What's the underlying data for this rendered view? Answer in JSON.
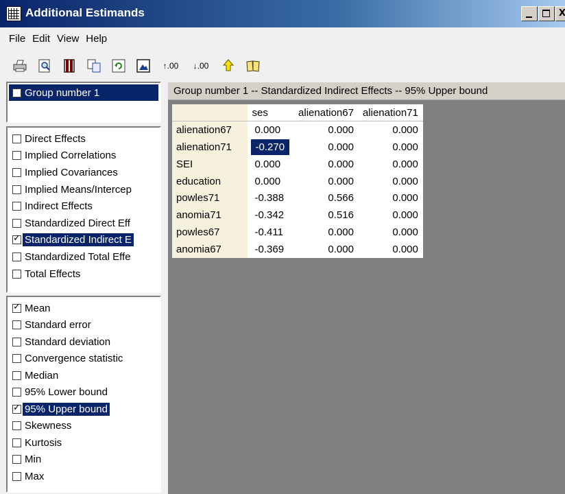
{
  "window": {
    "title": "Additional Estimands",
    "controls": {
      "minimize": "_",
      "maximize": "□",
      "close": "X"
    }
  },
  "menu": {
    "items": [
      {
        "label": "File"
      },
      {
        "label": "Edit"
      },
      {
        "label": "View"
      },
      {
        "label": "Help"
      }
    ]
  },
  "toolbar": {
    "icons": [
      "print-icon",
      "print-preview-icon",
      "columns-icon",
      "copy-icon",
      "refresh-icon",
      "image-icon",
      "increase-decimals-icon",
      "decrease-decimals-icon",
      "up-arrow-icon",
      "help-book-icon"
    ],
    "increase_decimals_text": ".00",
    "decrease_decimals_text": ".00"
  },
  "groups": {
    "items": [
      {
        "label": "Group number 1",
        "checked": false
      }
    ]
  },
  "estimands": {
    "items": [
      {
        "label": "Direct Effects",
        "checked": false,
        "selected": false
      },
      {
        "label": "Implied Correlations",
        "checked": false,
        "selected": false
      },
      {
        "label": "Implied Covariances",
        "checked": false,
        "selected": false
      },
      {
        "label": "Implied Means/Intercep",
        "checked": false,
        "selected": false
      },
      {
        "label": "Indirect Effects",
        "checked": false,
        "selected": false
      },
      {
        "label": "Standardized Direct Eff",
        "checked": false,
        "selected": false
      },
      {
        "label": "Standardized Indirect E",
        "checked": true,
        "selected": true
      },
      {
        "label": "Standardized Total Effe",
        "checked": false,
        "selected": false
      },
      {
        "label": "Total Effects",
        "checked": false,
        "selected": false
      }
    ]
  },
  "statistics": {
    "items": [
      {
        "label": "Mean",
        "checked": true,
        "selected": false
      },
      {
        "label": "Standard error",
        "checked": false,
        "selected": false
      },
      {
        "label": "Standard deviation",
        "checked": false,
        "selected": false
      },
      {
        "label": "Convergence statistic",
        "checked": false,
        "selected": false
      },
      {
        "label": "Median",
        "checked": false,
        "selected": false
      },
      {
        "label": "95% Lower bound",
        "checked": false,
        "selected": false
      },
      {
        "label": "95% Upper bound",
        "checked": true,
        "selected": true
      },
      {
        "label": "Skewness",
        "checked": false,
        "selected": false
      },
      {
        "label": "Kurtosis",
        "checked": false,
        "selected": false
      },
      {
        "label": "Min",
        "checked": false,
        "selected": false
      },
      {
        "label": "Max",
        "checked": false,
        "selected": false
      }
    ]
  },
  "results": {
    "caption": "Group number 1 -- Standardized Indirect Effects -- 95% Upper bound",
    "columns": [
      "ses",
      "alienation67",
      "alienation71"
    ],
    "rows": [
      {
        "name": "alienation67",
        "values": [
          "0.000",
          "0.000",
          "0.000"
        ]
      },
      {
        "name": "alienation71",
        "values": [
          "-0.270",
          "0.000",
          "0.000"
        ]
      },
      {
        "name": "SEI",
        "values": [
          "0.000",
          "0.000",
          "0.000"
        ]
      },
      {
        "name": "education",
        "values": [
          "0.000",
          "0.000",
          "0.000"
        ]
      },
      {
        "name": "powles71",
        "values": [
          "-0.388",
          "0.566",
          "0.000"
        ]
      },
      {
        "name": "anomia71",
        "values": [
          "-0.342",
          "0.516",
          "0.000"
        ]
      },
      {
        "name": "powles67",
        "values": [
          "-0.411",
          "0.000",
          "0.000"
        ]
      },
      {
        "name": "anomia67",
        "values": [
          "-0.369",
          "0.000",
          "0.000"
        ]
      }
    ],
    "highlighted_cell": {
      "row": 1,
      "col": 0
    }
  },
  "colors": {
    "selection": "#0a246a",
    "row_header_bg": "#f5f1dc",
    "content_bg": "#808080"
  }
}
